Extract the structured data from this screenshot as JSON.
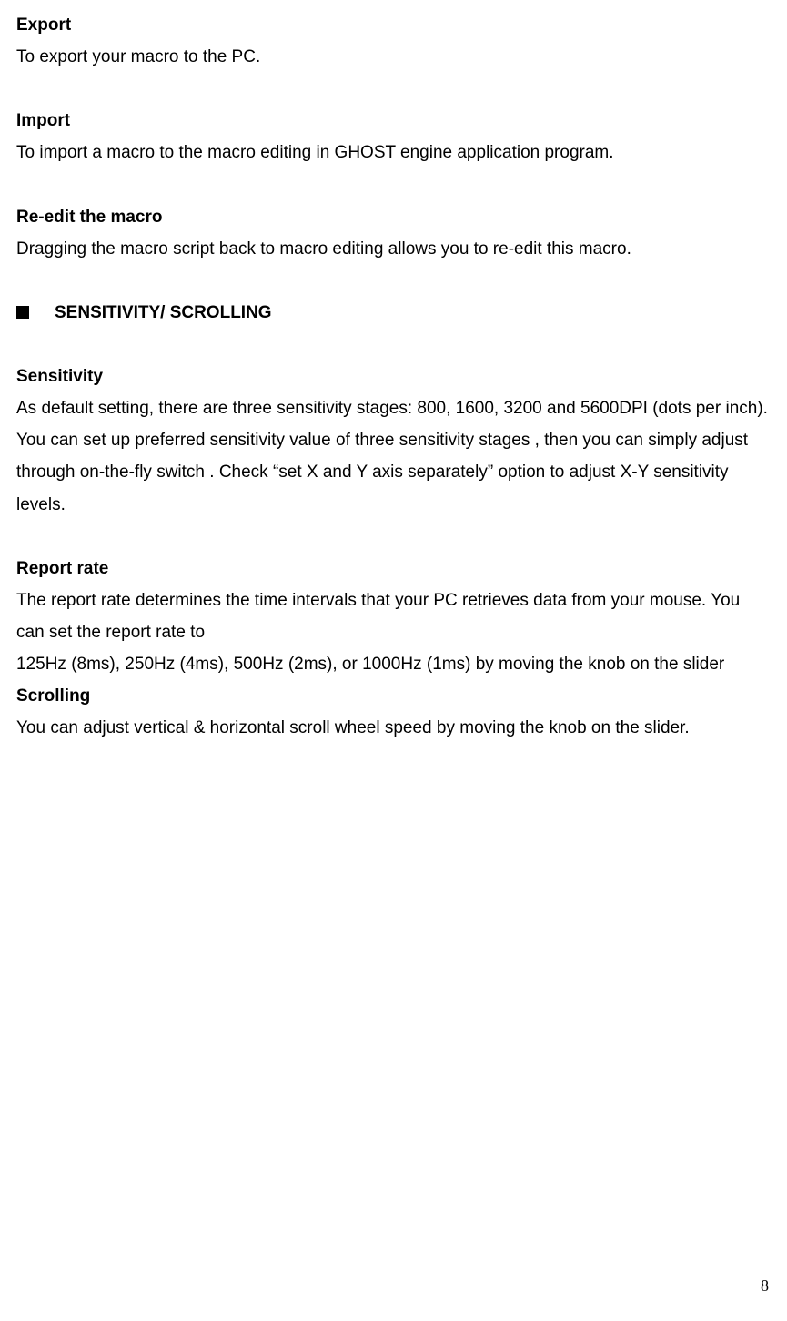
{
  "sections": {
    "export": {
      "heading": "Export",
      "body": "To export your macro to the PC."
    },
    "import": {
      "heading": "Import",
      "body": "To import a macro to the macro editing in GHOST engine application program."
    },
    "reedit": {
      "heading": "Re-edit the macro",
      "body": "Dragging the macro script back to macro editing allows you to re-edit this macro."
    },
    "sensitivityScrolling": {
      "heading": "SENSITIVITY/ SCROLLING"
    },
    "sensitivity": {
      "heading": "Sensitivity",
      "body": "As default setting, there are three sensitivity stages: 800, 1600, 3200 and 5600DPI (dots per inch). You can set up preferred sensitivity value of three sensitivity stages , then you can simply adjust through on-the-fly switch . Check “set X and Y axis separately” option to adjust X-Y sensitivity levels."
    },
    "reportRate": {
      "heading": "Report rate",
      "body1": "The report rate determines the time intervals that your PC retrieves data from your mouse. You can set the report rate to",
      "body2": "125Hz (8ms), 250Hz (4ms), 500Hz (2ms), or 1000Hz (1ms) by moving the knob on the slider"
    },
    "scrolling": {
      "heading": "Scrolling",
      "body": "You can adjust vertical & horizontal scroll wheel speed by moving the knob on the slider."
    }
  },
  "pageNumber": "8"
}
